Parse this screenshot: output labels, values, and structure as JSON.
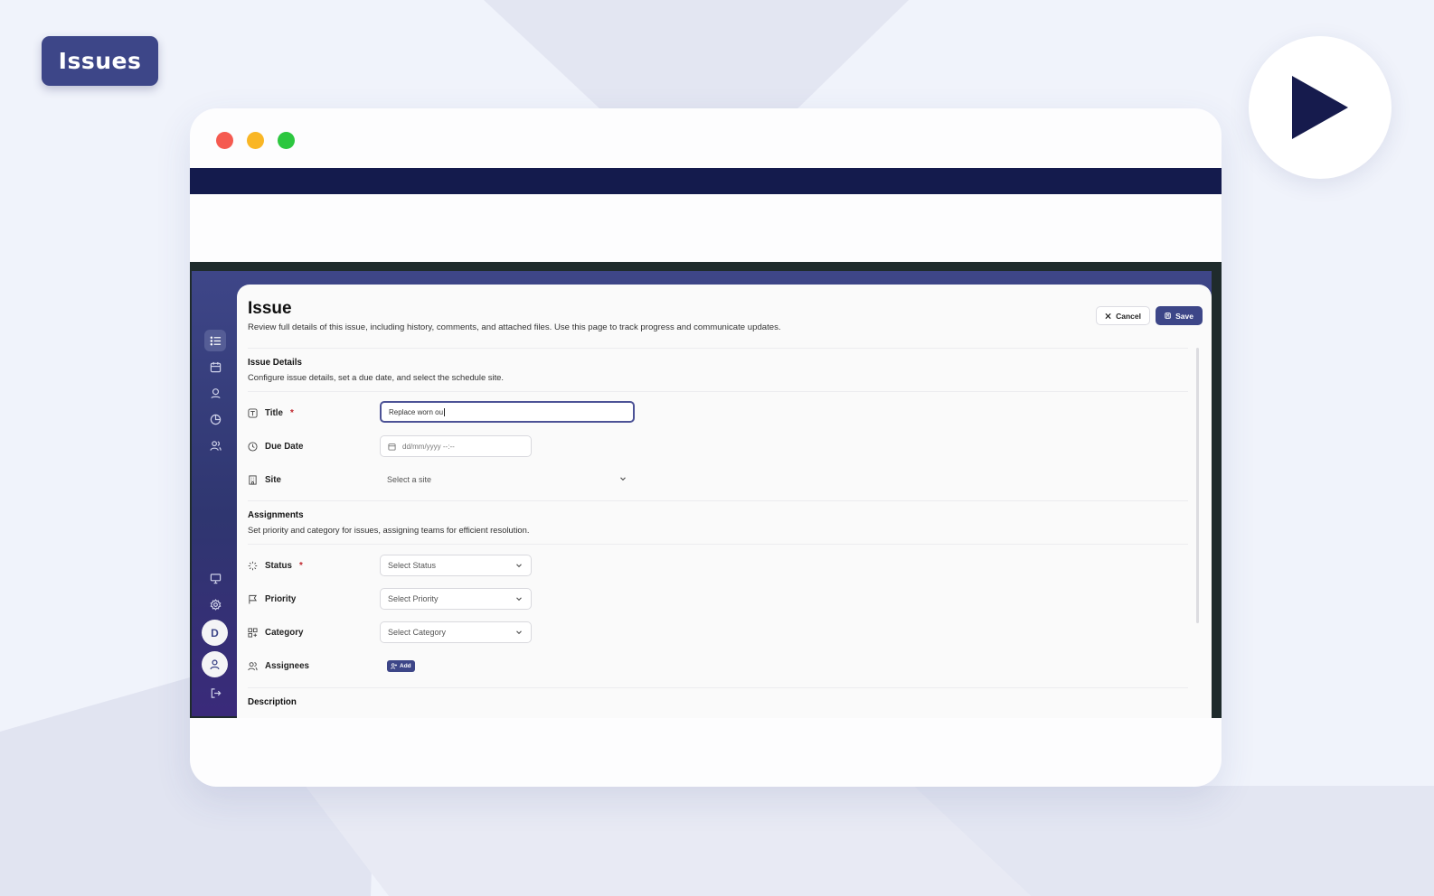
{
  "badge": {
    "label": "Issues"
  },
  "play": {
    "icon": "play-icon"
  },
  "window": {
    "controls": [
      "close",
      "minimize",
      "maximize"
    ],
    "colors": {
      "close": "#f55a50",
      "minimize": "#f9b625",
      "maximize": "#2cc73f",
      "nav_bar": "#141b4d"
    }
  },
  "sidebar": {
    "top_items": [
      {
        "name": "list-icon",
        "active": true
      },
      {
        "name": "calendar-icon",
        "active": false
      },
      {
        "name": "location-pin-icon",
        "active": false
      },
      {
        "name": "pie-chart-icon",
        "active": false
      },
      {
        "name": "users-icon",
        "active": false
      }
    ],
    "bottom_items": [
      {
        "name": "monitor-icon"
      },
      {
        "name": "gear-icon"
      }
    ],
    "avatar_initial": "D",
    "logout_icon": "logout-icon"
  },
  "page": {
    "title": "Issue",
    "subtitle": "Review full details of this issue, including history, comments, and attached files. Use this page to track progress and communicate updates.",
    "cancel_label": "Cancel",
    "save_label": "Save"
  },
  "issue_details": {
    "title": "Issue Details",
    "subtitle": "Configure issue details, set a due date, and select the schedule site.",
    "fields": {
      "title_label": "Title",
      "title_value": "Replace worn ou",
      "due_date_label": "Due Date",
      "due_date_placeholder": "dd/mm/yyyy --:--",
      "site_label": "Site",
      "site_placeholder": "Select a site"
    }
  },
  "assignments": {
    "title": "Assignments",
    "subtitle": "Set priority and category for issues, assigning teams for efficient resolution.",
    "fields": {
      "status_label": "Status",
      "status_placeholder": "Select Status",
      "priority_label": "Priority",
      "priority_placeholder": "Select Priority",
      "category_label": "Category",
      "category_placeholder": "Select Category",
      "assignees_label": "Assignees",
      "add_label": "Add"
    }
  },
  "description": {
    "title": "Description"
  },
  "colors": {
    "brand": "#3d4688",
    "required": "#c0262d"
  }
}
